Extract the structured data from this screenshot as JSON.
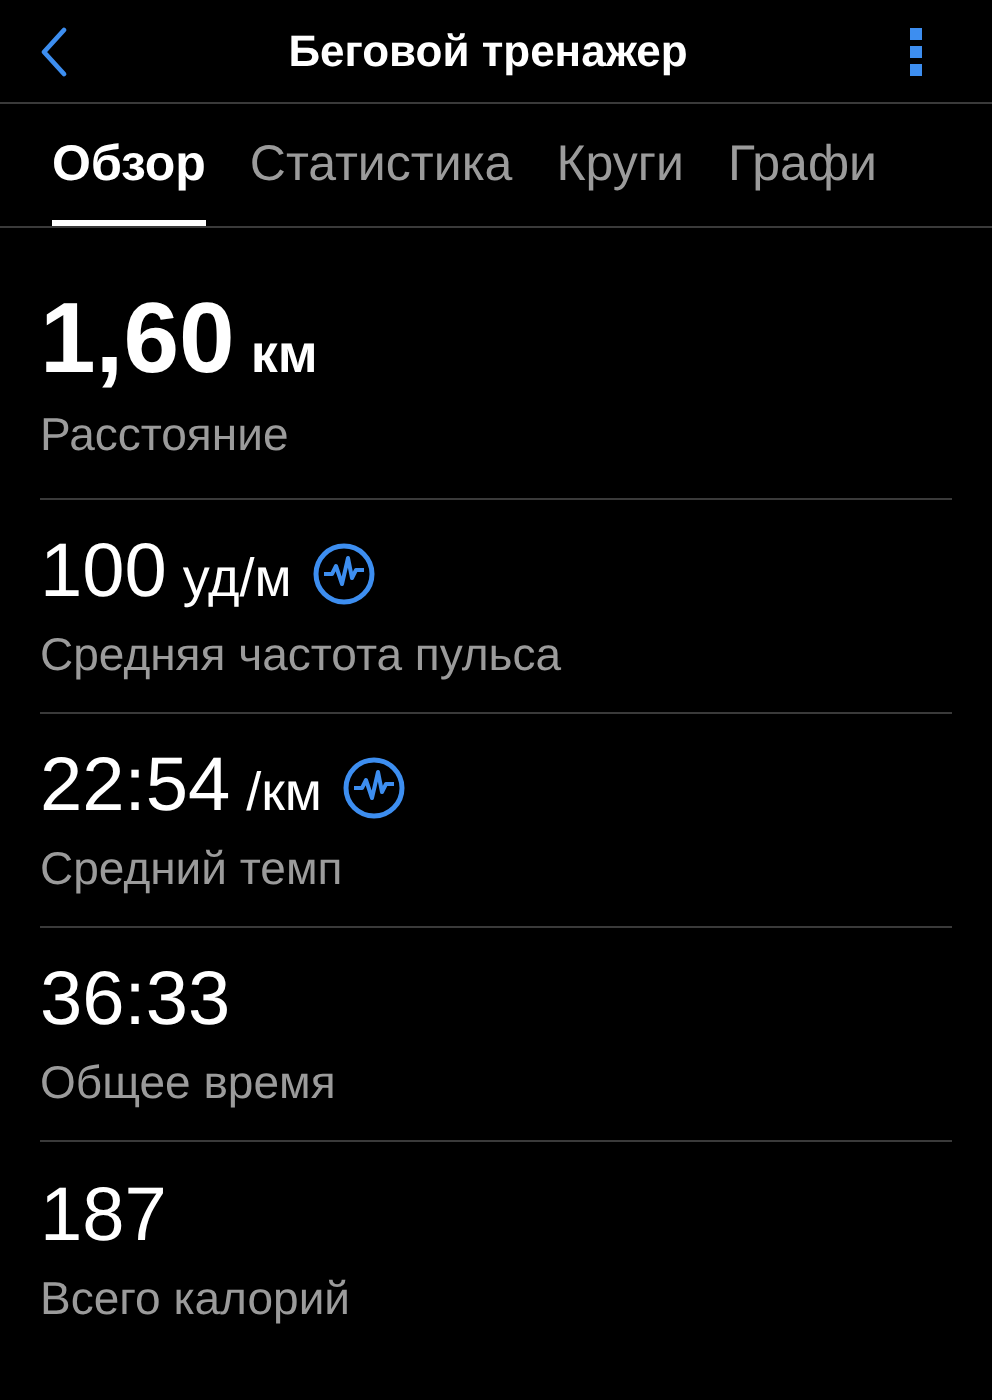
{
  "header": {
    "title": "Беговой тренажер"
  },
  "tabs": [
    {
      "label": "Обзор",
      "selected": true
    },
    {
      "label": "Статистика",
      "selected": false
    },
    {
      "label": "Круги",
      "selected": false
    },
    {
      "label": "Графи",
      "selected": false
    }
  ],
  "metrics": [
    {
      "kind": "primary",
      "value": "1,60",
      "unit": "км",
      "label": "Расстояние",
      "chart_icon": false
    },
    {
      "kind": "normal",
      "value": "100",
      "unit": "уд/м",
      "label": "Средняя частота пульса",
      "chart_icon": true
    },
    {
      "kind": "normal",
      "value": "22:54",
      "unit": "/км",
      "label": "Средний темп",
      "chart_icon": true
    },
    {
      "kind": "normal",
      "value": "36:33",
      "label": "Общее время",
      "chart_icon": false
    },
    {
      "kind": "normal",
      "value": "187",
      "label": "Всего калорий",
      "chart_icon": false
    }
  ]
}
